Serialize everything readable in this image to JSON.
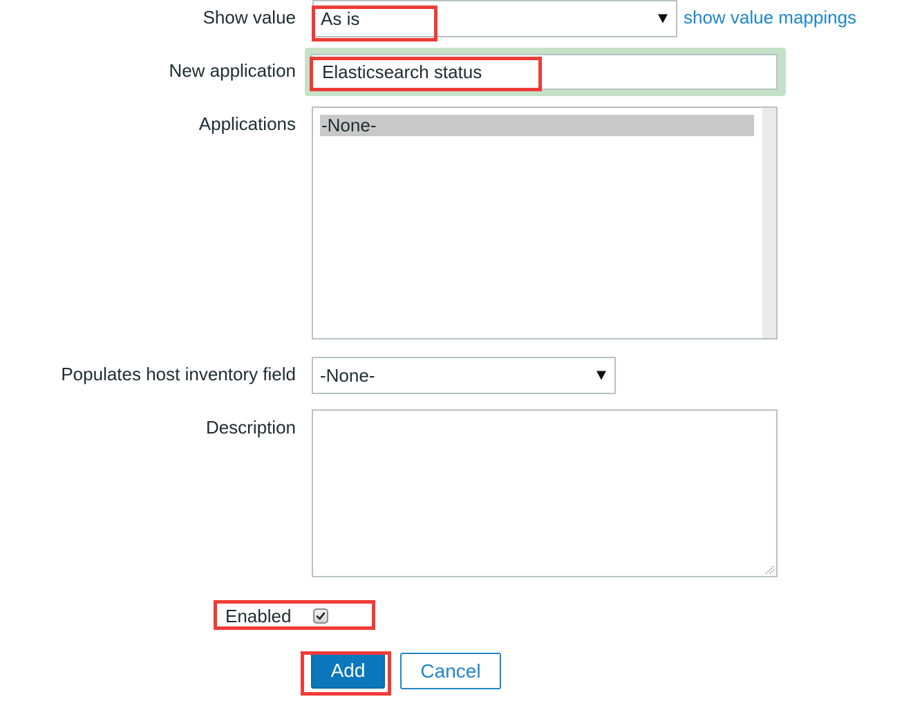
{
  "form": {
    "show_value": {
      "label": "Show value",
      "selected": "As is",
      "link_label": "show value mappings"
    },
    "new_application": {
      "label": "New application",
      "value": "Elasticsearch status"
    },
    "applications": {
      "label": "Applications",
      "options": [
        "-None-"
      ],
      "selected": "-None-"
    },
    "inventory_field": {
      "label": "Populates host inventory field",
      "selected": "-None-"
    },
    "description": {
      "label": "Description",
      "value": ""
    },
    "enabled": {
      "label": "Enabled",
      "checked": true
    }
  },
  "actions": {
    "add_label": "Add",
    "cancel_label": "Cancel"
  },
  "colors": {
    "highlight": "#ef3b36",
    "primary": "#0b77bd",
    "link": "#1f86c8",
    "focus": "#c5e1c8"
  }
}
